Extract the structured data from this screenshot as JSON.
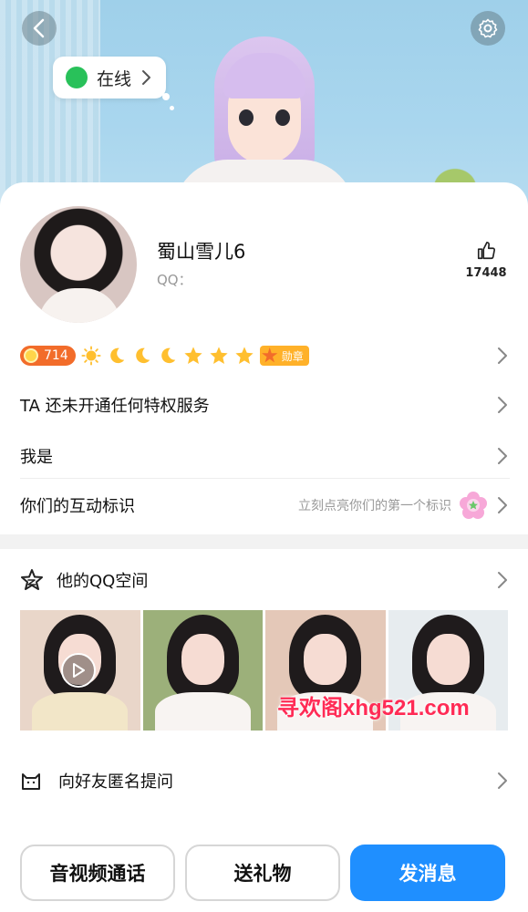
{
  "header": {
    "status_label": "在线",
    "back_icon": "chevron-left-icon",
    "settings_icon": "gear-icon"
  },
  "profile": {
    "nickname": "蜀山雪儿6",
    "qq_label": "QQ：",
    "like_count": "17448"
  },
  "level_row": {
    "level_number": "714",
    "level_icons": [
      "sun-icon",
      "moon-icon",
      "moon-icon",
      "moon-icon",
      "star-icon",
      "star-icon",
      "star-icon"
    ],
    "medal_label": "勋章"
  },
  "rows": {
    "privilege": "TA 还未开通任何特权服务",
    "i_am": "我是",
    "interaction": {
      "title": "你们的互动标识",
      "hint": "立刻点亮你们的第一个标识"
    },
    "qzone": "他的QQ空间",
    "anonymous": "向好友匿名提问"
  },
  "buttons": {
    "call": "音视频通话",
    "gift": "送礼物",
    "message": "发消息"
  },
  "watermark": "寻欢阁xhg521.com",
  "colors": {
    "accent": "#1f8fff",
    "online": "#29c15a",
    "level": "#f26c2a",
    "watermark": "#ff2b55"
  }
}
